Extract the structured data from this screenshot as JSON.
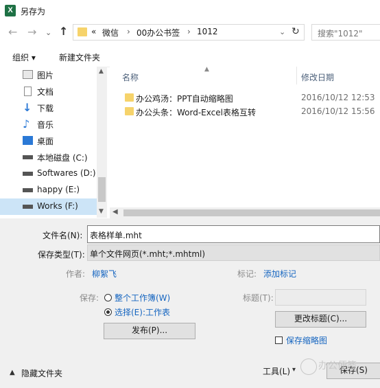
{
  "window": {
    "title": "另存为",
    "app_icon": "excel-icon"
  },
  "nav": {
    "address_segments": [
      "«",
      "微信",
      "00办公书签",
      "1012"
    ],
    "separator": "›",
    "search_placeholder": "搜索\"1012\""
  },
  "toolbar": {
    "organize": "组织 ▾",
    "new_folder": "新建文件夹"
  },
  "tree": {
    "items": [
      {
        "label": "图片",
        "icon": "pictures-icon"
      },
      {
        "label": "文档",
        "icon": "documents-icon"
      },
      {
        "label": "下载",
        "icon": "download-icon"
      },
      {
        "label": "音乐",
        "icon": "music-icon"
      },
      {
        "label": "桌面",
        "icon": "desktop-icon"
      },
      {
        "label": "本地磁盘 (C:)",
        "icon": "drive-icon"
      },
      {
        "label": "Softwares (D:)",
        "icon": "drive-icon"
      },
      {
        "label": "happy (E:)",
        "icon": "drive-icon"
      },
      {
        "label": "Works (F:)",
        "icon": "drive-icon",
        "selected": true
      }
    ]
  },
  "file_list": {
    "columns": {
      "name": "名称",
      "modified": "修改日期"
    },
    "rows": [
      {
        "name": "办公鸡汤：PPT自动缩略图",
        "modified": "2016/10/12 12:53"
      },
      {
        "name": "办公头条：Word-Excel表格互转",
        "modified": "2016/10/12 15:56"
      }
    ]
  },
  "form": {
    "filename_label": "文件名(N):",
    "filename_value": "表格样单.mht",
    "filetype_label": "保存类型(T):",
    "filetype_value": "单个文件网页(*.mht;*.mhtml)",
    "author_label": "作者:",
    "author_value": "柳絮飞",
    "tags_label": "标记:",
    "tags_value": "添加标记",
    "save_label": "保存:",
    "radio_workbook": "整个工作簿(W)",
    "radio_selection": "选择(E):工作表",
    "title_label": "标题(T):",
    "change_title": "更改标题(C)...",
    "publish": "发布(P)...",
    "save_thumbnail": "保存缩略图",
    "hide_folders": "隐藏文件夹",
    "tools": "工具(L)",
    "save_button": "保存(S)"
  },
  "watermark": "办公便签"
}
